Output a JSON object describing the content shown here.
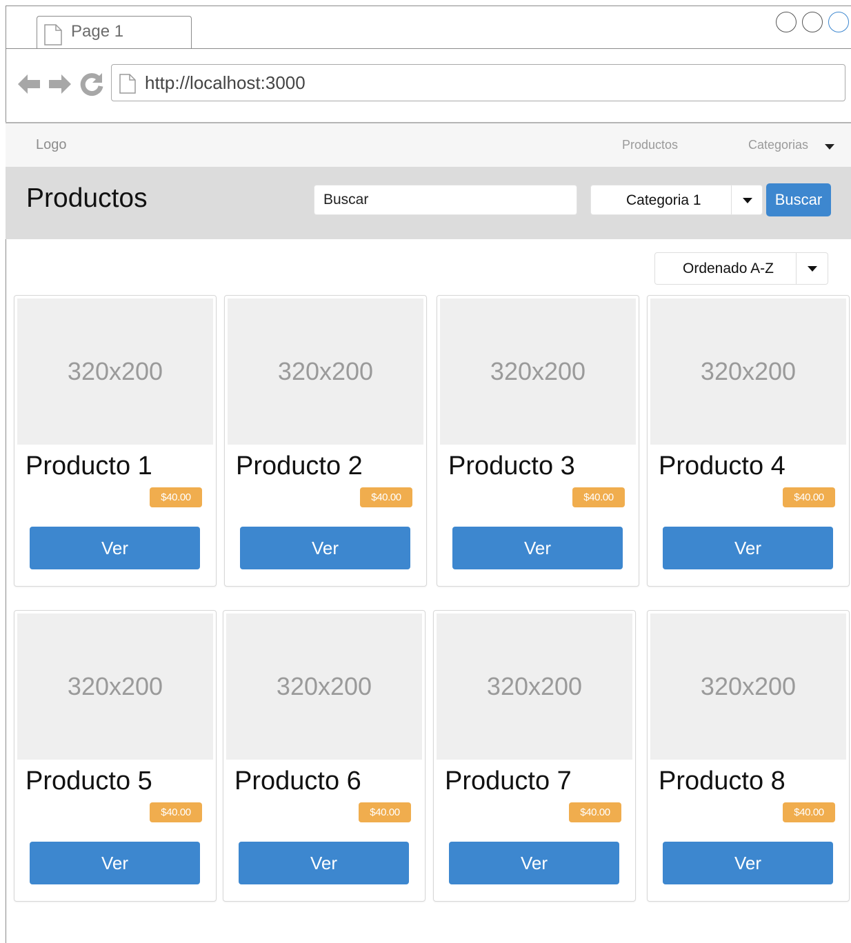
{
  "browser": {
    "tab_title": "Page 1",
    "url": "http://localhost:3000"
  },
  "navbar": {
    "logo": "Logo",
    "products_link": "Productos",
    "categories_link": "Categorias"
  },
  "header": {
    "title": "Productos",
    "search_placeholder": "Buscar",
    "category_selected": "Categoria 1",
    "search_button": "Buscar"
  },
  "sort": {
    "selected": "Ordenado A-Z"
  },
  "products": [
    {
      "image_label": "320x200",
      "name": "Producto 1",
      "price": "$40.00",
      "button": "Ver"
    },
    {
      "image_label": "320x200",
      "name": "Producto 2",
      "price": "$40.00",
      "button": "Ver"
    },
    {
      "image_label": "320x200",
      "name": "Producto 3",
      "price": "$40.00",
      "button": "Ver"
    },
    {
      "image_label": "320x200",
      "name": "Producto 4",
      "price": "$40.00",
      "button": "Ver"
    },
    {
      "image_label": "320x200",
      "name": "Producto 5",
      "price": "$40.00",
      "button": "Ver"
    },
    {
      "image_label": "320x200",
      "name": "Producto 6",
      "price": "$40.00",
      "button": "Ver"
    },
    {
      "image_label": "320x200",
      "name": "Producto 7",
      "price": "$40.00",
      "button": "Ver"
    },
    {
      "image_label": "320x200",
      "name": "Producto 8",
      "price": "$40.00",
      "button": "Ver"
    }
  ],
  "colors": {
    "primary": "#3d87cf",
    "price_badge": "#f0ad4e",
    "header_band": "#dcdcdc",
    "navbar": "#f6f6f6",
    "placeholder_image": "#efefef"
  }
}
